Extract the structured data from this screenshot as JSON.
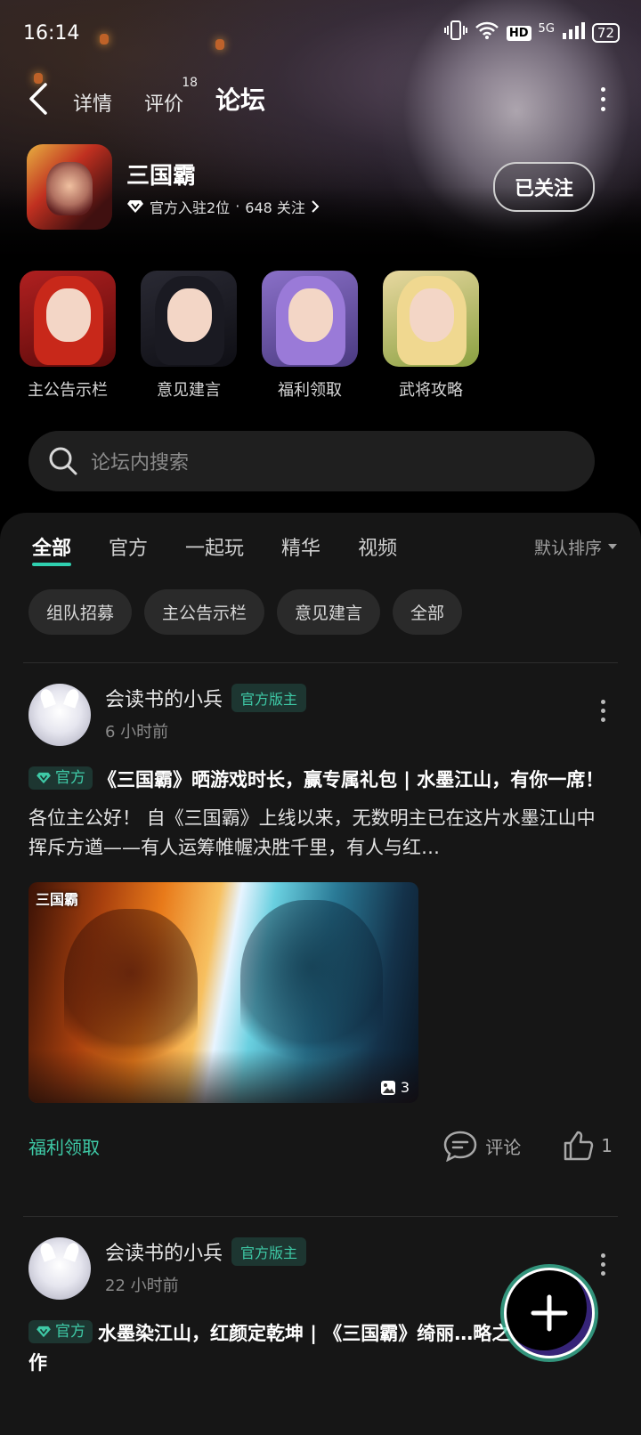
{
  "status_bar": {
    "time": "16:14",
    "network": "5G",
    "hd": "HD",
    "battery": "72"
  },
  "nav": {
    "tabs": [
      {
        "label": "详情"
      },
      {
        "label": "评价",
        "badge": "18"
      },
      {
        "label": "论坛"
      }
    ],
    "active_tab": "论坛"
  },
  "game": {
    "name": "三国霸",
    "official_count": "官方入驻2位",
    "separator": "·",
    "followers": "648 关注",
    "follow_button": "已关注"
  },
  "shortcuts": [
    {
      "label": "主公告示栏"
    },
    {
      "label": "意见建言"
    },
    {
      "label": "福利领取"
    },
    {
      "label": "武将攻略"
    }
  ],
  "search": {
    "placeholder": "论坛内搜索"
  },
  "filter_tabs": [
    {
      "label": "全部"
    },
    {
      "label": "官方"
    },
    {
      "label": "一起玩"
    },
    {
      "label": "精华"
    },
    {
      "label": "视频"
    }
  ],
  "sort": {
    "label": "默认排序"
  },
  "chips": [
    {
      "label": "组队招募"
    },
    {
      "label": "主公告示栏"
    },
    {
      "label": "意见建言"
    },
    {
      "label": "全部"
    }
  ],
  "posts": [
    {
      "author": "会读书的小兵",
      "role": "官方版主",
      "time": "6 小时前",
      "tag": "官方",
      "title": "《三国霸》晒游戏时长，赢专属礼包 | 水墨江山，有你一席！",
      "body": "各位主公好！ 自《三国霸》上线以来，无数明主已在这片水墨江山中挥斥方遒——有人运筹帷幄决胜千里，有人与红…",
      "image_logo": "三国霸",
      "image_count": "3",
      "topic": "福利领取",
      "comment_label": "评论",
      "likes": "1"
    },
    {
      "author": "会读书的小兵",
      "role": "官方版主",
      "time": "22 小时前",
      "tag": "官方",
      "title": "水墨染江山，红颜定乾坤 | 《三国霸》绮丽…略之作"
    }
  ],
  "colors": {
    "accent": "#3ec9a6",
    "background": "#000000",
    "panel": "#161616"
  }
}
